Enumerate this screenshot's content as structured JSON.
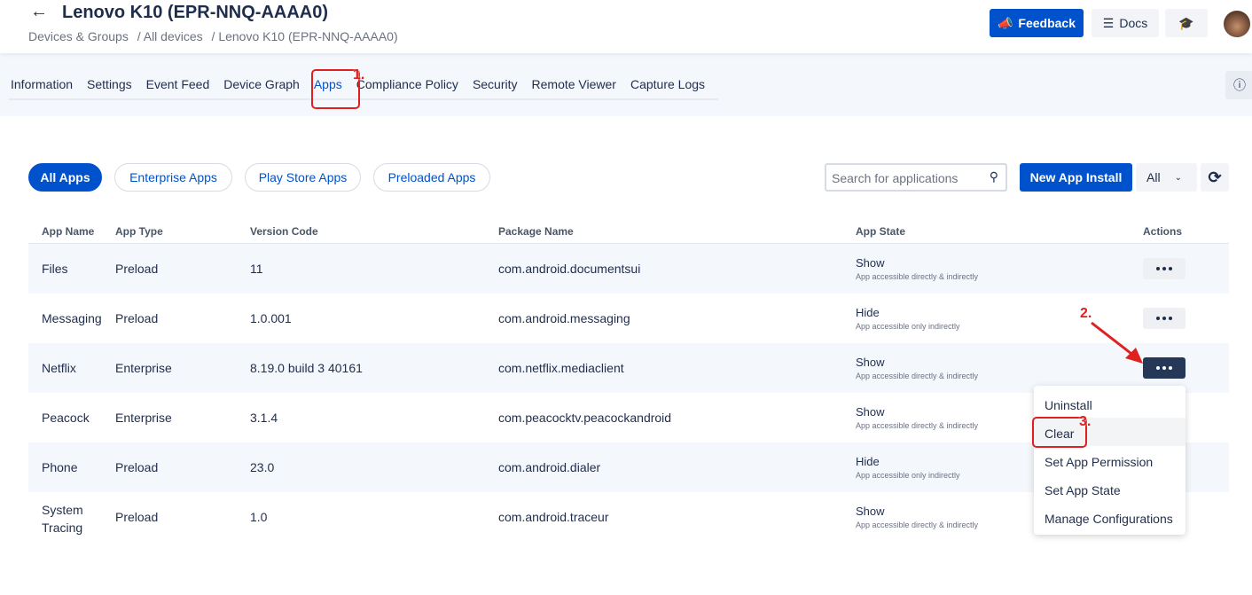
{
  "header": {
    "title": "Lenovo K10 (EPR-NNQ-AAAA0)",
    "breadcrumb": [
      "Devices & Groups",
      "/ All devices",
      "/ Lenovo K10 (EPR-NNQ-AAAA0)"
    ],
    "feedback": "Feedback",
    "docs": "Docs"
  },
  "tabs": [
    "Information",
    "Settings",
    "Event Feed",
    "Device Graph",
    "Apps",
    "Compliance Policy",
    "Security",
    "Remote Viewer",
    "Capture Logs"
  ],
  "filters": [
    "All Apps",
    "Enterprise Apps",
    "Play Store Apps",
    "Preloaded Apps"
  ],
  "search": {
    "placeholder": "Search for applications"
  },
  "new_install": "New App Install",
  "type_select": "All",
  "columns": [
    "App Name",
    "App Type",
    "Version Code",
    "Package Name",
    "App State",
    "Actions"
  ],
  "rows": [
    {
      "name": "Files",
      "type": "Preload",
      "version": "11",
      "package": "com.android.documentsui",
      "state": "Show",
      "desc": "App accessible directly & indirectly"
    },
    {
      "name": "Messaging",
      "type": "Preload",
      "version": "1.0.001",
      "package": "com.android.messaging",
      "state": "Hide",
      "desc": "App accessible only indirectly"
    },
    {
      "name": "Netflix",
      "type": "Enterprise",
      "version": "8.19.0 build 3 40161",
      "package": "com.netflix.mediaclient",
      "state": "Show",
      "desc": "App accessible directly & indirectly"
    },
    {
      "name": "Peacock",
      "type": "Enterprise",
      "version": "3.1.4",
      "package": "com.peacocktv.peacockandroid",
      "state": "Show",
      "desc": "App accessible directly & indirectly"
    },
    {
      "name": "Phone",
      "type": "Preload",
      "version": "23.0",
      "package": "com.android.dialer",
      "state": "Hide",
      "desc": "App accessible only indirectly"
    },
    {
      "name": "System Tracing",
      "type": "Preload",
      "version": "1.0",
      "package": "com.android.traceur",
      "state": "Show",
      "desc": "App accessible directly & indirectly"
    }
  ],
  "menu": [
    "Uninstall",
    "Clear",
    "Set App Permission",
    "Set App State",
    "Manage Configurations"
  ],
  "annotations": [
    "1.",
    "2.",
    "3."
  ]
}
